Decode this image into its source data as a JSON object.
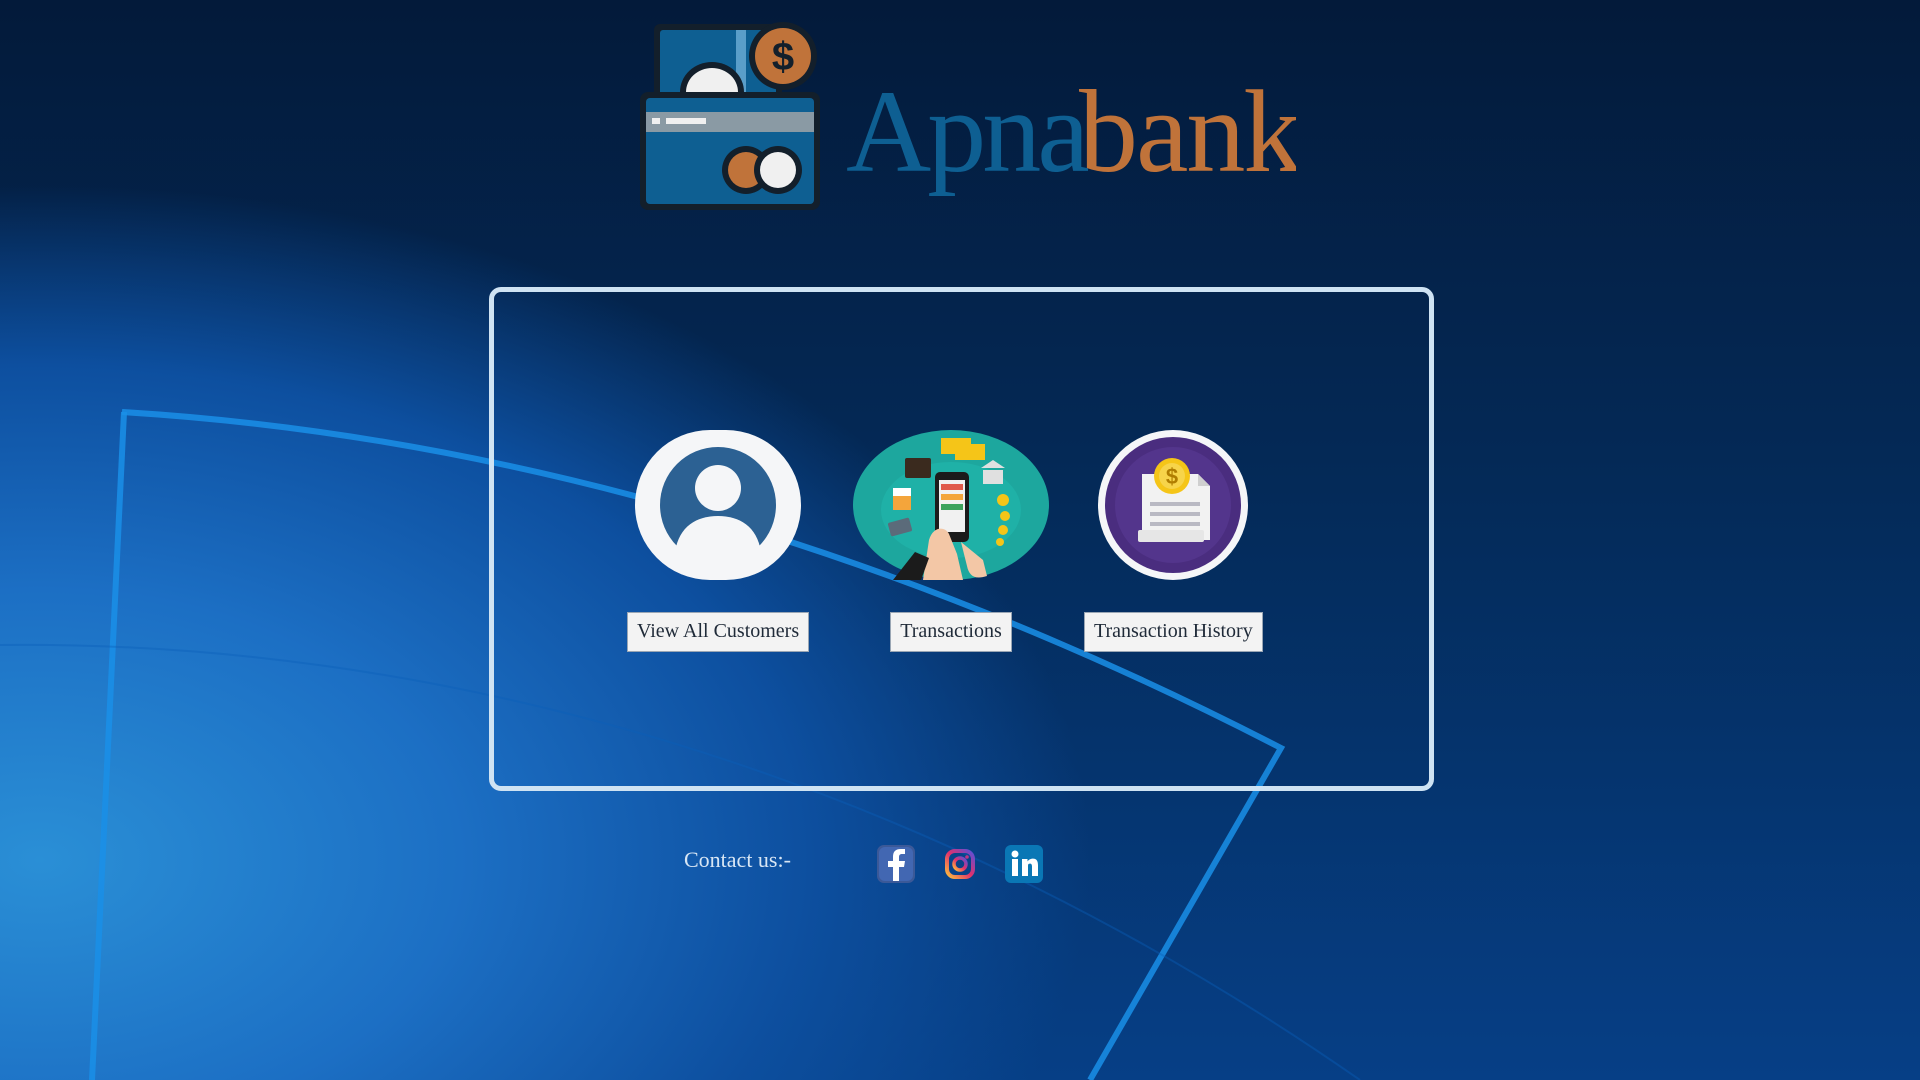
{
  "logo": {
    "name_part1": "Apna",
    "name_part2": "bank",
    "colors": {
      "blue": "#0e5f92",
      "orange": "#c0733a",
      "dark": "#131f2b"
    }
  },
  "nav": {
    "customers": {
      "label": "View All Customers",
      "icon": "user-avatar-icon"
    },
    "transactions": {
      "label": "Transactions",
      "icon": "mobile-payment-icon"
    },
    "history": {
      "label": "Transaction History",
      "icon": "receipt-coin-icon"
    }
  },
  "footer": {
    "contact_label": "Contact us:-",
    "social": [
      {
        "name": "facebook-icon",
        "color": "#3b5998"
      },
      {
        "name": "instagram-icon",
        "color": "#c13584"
      },
      {
        "name": "linkedin-icon",
        "color": "#0a77b5"
      }
    ]
  },
  "theme": {
    "panel_border": "#cfe3f3",
    "accent_line": "#1a8fe8"
  }
}
